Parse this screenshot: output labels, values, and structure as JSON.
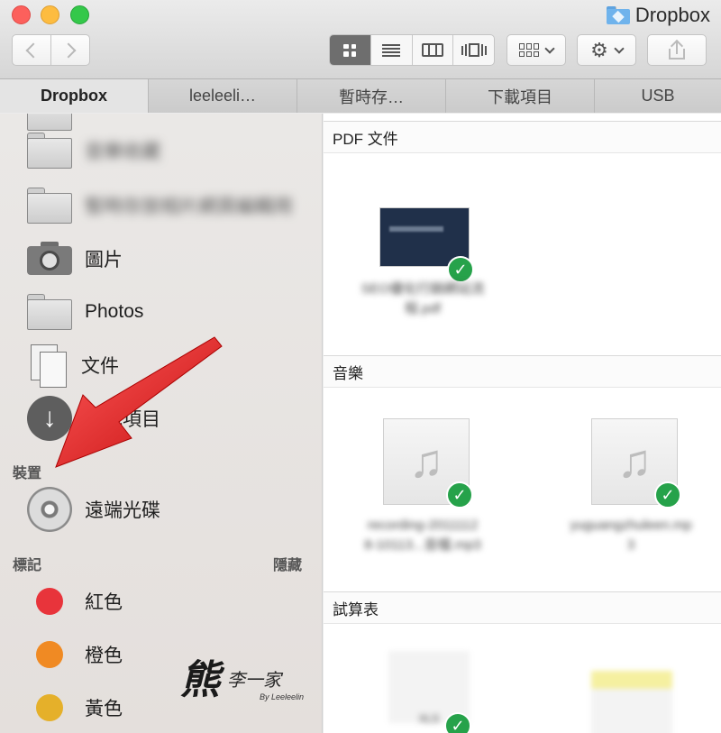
{
  "window": {
    "title": "Dropbox"
  },
  "tabs": [
    {
      "label": "Dropbox",
      "active": true
    },
    {
      "label": "leeleeli…"
    },
    {
      "label": "暫時存…"
    },
    {
      "label": "下載項目"
    },
    {
      "label": "USB"
    }
  ],
  "sidebar": {
    "favorites": [
      {
        "label": "音樂收藏",
        "icon": "folder-icon",
        "blurred": true
      },
      {
        "label": "暫時存放相片網頁編輯用",
        "icon": "folder-icon",
        "blurred": true
      },
      {
        "label": "圖片",
        "icon": "camera-icon"
      },
      {
        "label": "Photos",
        "icon": "folder-icon"
      },
      {
        "label": "文件",
        "icon": "document-icon"
      },
      {
        "label": "下載項目",
        "icon": "download-icon"
      }
    ],
    "devices_header": "裝置",
    "devices": [
      {
        "label": "遠端光碟",
        "icon": "disc-icon"
      }
    ],
    "tags_header": "標記",
    "tags_hide": "隱藏",
    "tags": [
      {
        "label": "紅色",
        "color": "#e8343b"
      },
      {
        "label": "橙色",
        "color": "#f08a23"
      },
      {
        "label": "黃色",
        "color": "#e5b02a"
      }
    ]
  },
  "main": {
    "groups": [
      {
        "title": "PDF 文件",
        "files": [
          {
            "name_line1": "SEO優化行銷網站流",
            "name_line2": "程.pdf",
            "synced": true
          }
        ]
      },
      {
        "title": "音樂",
        "files": [
          {
            "name_line1": "recording-2011112",
            "name_line2": "8-10113...音檔.mp3",
            "synced": true
          },
          {
            "name_line1": "yuguangzhuleen.mp",
            "name_line2": "3",
            "synced": true
          }
        ]
      },
      {
        "title": "試算表",
        "files": [
          {
            "name_line1": "XLS",
            "synced": true
          },
          {
            "name_line1": "",
            "synced": false
          }
        ]
      }
    ]
  },
  "watermark": {
    "main": "熊",
    "text": "李一家",
    "sub": "By Leeleelin"
  },
  "colors": {
    "check_green": "#26a24a",
    "annotation_arrow": "#e21b1b",
    "active_view": "#6e6e6e"
  }
}
